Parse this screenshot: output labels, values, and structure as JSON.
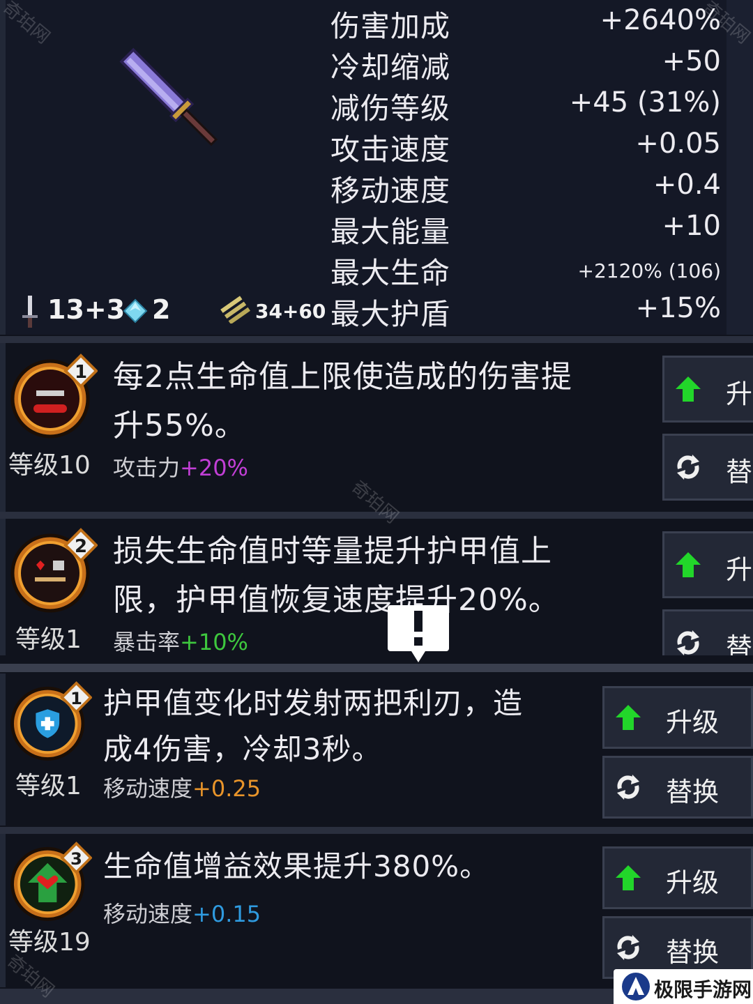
{
  "weapon": {
    "stats": [
      {
        "name": "伤害加成",
        "value": "+2640%"
      },
      {
        "name": "冷却缩减",
        "value": "+50"
      },
      {
        "name": "减伤等级",
        "value": "+45 (31%)"
      },
      {
        "name": "攻击速度",
        "value": "+0.05"
      },
      {
        "name": "移动速度",
        "value": "+0.4"
      },
      {
        "name": "最大能量",
        "value": "+10"
      },
      {
        "name": "最大生命",
        "value": "+2120% (106)"
      },
      {
        "name": "最大护盾",
        "value": "+15%"
      }
    ],
    "attack": "13+3",
    "crystals": "2",
    "ammo": "34+60"
  },
  "talents": [
    {
      "rank": "1",
      "level": "等级10",
      "desc_line1": "每2点生命值上限使造成的伤害提",
      "desc_line2": "升55%。",
      "bonus_label": "攻击力",
      "bonus_value": "+20%",
      "bonus_color": "#c23fd6",
      "upgrade_label": "升",
      "replace_label": "替"
    },
    {
      "rank": "2",
      "level": "等级1",
      "desc_line1": "损失生命值时等量提升护甲值上",
      "desc_line2": "限，护甲值恢复速度提升20%。",
      "bonus_label": "暴击率",
      "bonus_value": "+10%",
      "bonus_color": "#3ec83e",
      "upgrade_label": "升",
      "replace_label": "替"
    },
    {
      "rank": "1",
      "level": "等级1",
      "desc_line1": "护甲值变化时发射两把利刃，造",
      "desc_line2": "成4伤害，冷却3秒。",
      "bonus_label": "移动速度",
      "bonus_value": "+0.25",
      "bonus_color": "#e8942a",
      "upgrade_label": "升级",
      "replace_label": "替换"
    },
    {
      "rank": "3",
      "level": "等级19",
      "desc_line1": "生命值增益效果提升380%。",
      "desc_line2": "",
      "bonus_label": "移动速度",
      "bonus_value": "+0.15",
      "bonus_color": "#2f9be0",
      "upgrade_label": "升级",
      "replace_label": "替换"
    }
  ],
  "watermark": "奇珀网",
  "site_logo": "极限手游网",
  "colors": {
    "upgrade_arrow": "#22d62a",
    "panel_bg": "#141826",
    "button_bg": "#232836"
  }
}
